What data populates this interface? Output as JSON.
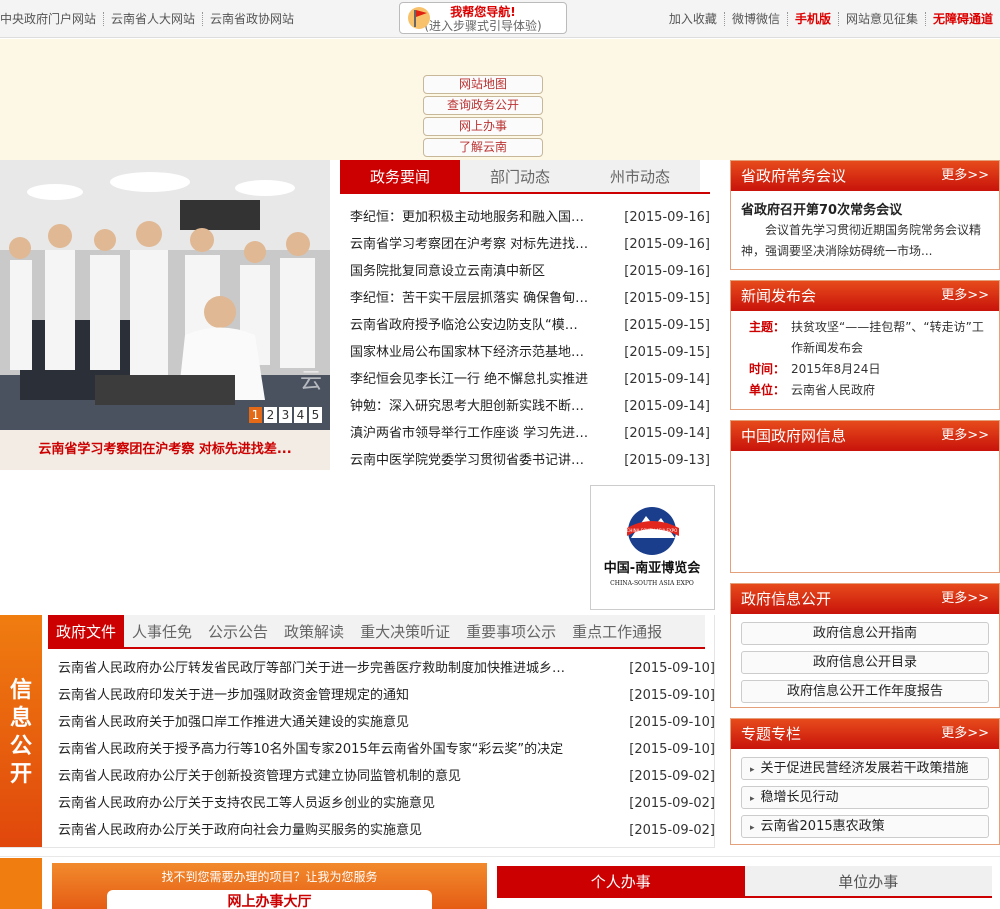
{
  "topbar": {
    "left_links": [
      "中央政府门户网站",
      "云南省人大网站",
      "云南省政协网站"
    ],
    "guide_title": "我帮您导航!",
    "guide_sub": "(进入步骤式引导体验)",
    "right_links": [
      "加入收藏",
      "微博微信",
      "手机版",
      "网站意见征集",
      "无障碍通道"
    ]
  },
  "header_nav": [
    "网站地图",
    "查询政务公开",
    "网上办事",
    "了解云南"
  ],
  "slideshow": {
    "caption": "云南省学习考察团在沪考察 对标先进找差...",
    "pages": [
      "1",
      "2",
      "3",
      "4",
      "5"
    ],
    "active_page": 1
  },
  "news": {
    "tabs": [
      "政务要闻",
      "部门动态",
      "州市动态"
    ],
    "items": [
      {
        "title": "李纪恒：更加积极主动地服务和融入国家战略",
        "date": "[2015-09-16]"
      },
      {
        "title": "云南省学习考察团在沪考察 对标先进找差距",
        "date": "[2015-09-16]"
      },
      {
        "title": "国务院批复同意设立云南滇中新区",
        "date": "[2015-09-16]"
      },
      {
        "title": "李纪恒：苦干实干层层抓落实 确保鲁甸灾后重建",
        "date": "[2015-09-15]"
      },
      {
        "title": "云南省政府授予临沧公安边防支队“模范边防支队”",
        "date": "[2015-09-15]"
      },
      {
        "title": "国家林业局公布国家林下经济示范基地名单",
        "date": "[2015-09-15]"
      },
      {
        "title": "李纪恒会见李长江一行 绝不懈怠扎实推进",
        "date": "[2015-09-14]"
      },
      {
        "title": "钟勉：深入研究思考大胆创新实践不断推进",
        "date": "[2015-09-14]"
      },
      {
        "title": "滇沪两省市领导举行工作座谈 学习先进经验",
        "date": "[2015-09-14]"
      },
      {
        "title": "云南中医学院党委学习贯彻省委书记讲话精神",
        "date": "[2015-09-13]"
      }
    ]
  },
  "expo": {
    "cn": "中国-南亚博览会",
    "en": "CHINA-SOUTH ASIA EXPO",
    "badge": "CHINA-SOUTH ASIA EXPO"
  },
  "right": {
    "more": "更多>>",
    "meeting": {
      "title": "省政府常务会议",
      "headline": "省政府召开第70次常务会议",
      "body": "会议首先学习贯彻近期国务院常务会议精神，强调要坚决消除妨碍统一市场..."
    },
    "press": {
      "title": "新闻发布会",
      "topic_label": "主题：",
      "topic": "扶贫攻坚“——挂包帮”、“转走访”工作新闻发布会",
      "time_label": "时间：",
      "time": "2015年8月24日",
      "unit_label": "单位：",
      "unit": "云南省人民政府"
    },
    "gov_net": {
      "title": "中国政府网信息"
    },
    "info_open": {
      "title": "政府信息公开",
      "items": [
        "政府信息公开指南",
        "政府信息公开目录",
        "政府信息公开工作年度报告"
      ]
    },
    "topics": {
      "title": "专题专栏",
      "items": [
        "关于促进民营经济发展若干政策措施",
        "稳增长见行动",
        "云南省2015惠农政策"
      ]
    }
  },
  "info_public": {
    "side_label": [
      "信",
      "息",
      "公",
      "开"
    ],
    "tabs": [
      "政府文件",
      "人事任免",
      "公示公告",
      "政策解读",
      "重大决策听证",
      "重要事项公示",
      "重点工作通报"
    ],
    "items": [
      {
        "title": "云南省人民政府办公厅转发省民政厅等部门关于进一步完善医疗救助制度加快推进城乡居民大病保险工作的意见",
        "date": "[2015-09-10]"
      },
      {
        "title": "云南省人民政府印发关于进一步加强财政资金管理规定的通知",
        "date": "[2015-09-10]"
      },
      {
        "title": "云南省人民政府关于加强口岸工作推进大通关建设的实施意见",
        "date": "[2015-09-10]"
      },
      {
        "title": "云南省人民政府关于授予高力行等10名外国专家2015年云南省外国专家“彩云奖”的决定",
        "date": "[2015-09-10]"
      },
      {
        "title": "云南省人民政府办公厅关于创新投资管理方式建立协同监管机制的意见",
        "date": "[2015-09-02]"
      },
      {
        "title": "云南省人民政府办公厅关于支持农民工等人员返乡创业的实施意见",
        "date": "[2015-09-02]"
      },
      {
        "title": "云南省人民政府办公厅关于政府向社会力量购买服务的实施意见",
        "date": "[2015-09-02]"
      }
    ]
  },
  "bottom": {
    "hint": "找不到您需要办理的项目？让我为您服务",
    "hall": "网上办事大厅",
    "tabs": [
      "个人办事",
      "单位办事"
    ]
  },
  "colors": {
    "accent": "#cc0000",
    "orange": "#f07d10",
    "header_bg": "#fdf7e6"
  }
}
